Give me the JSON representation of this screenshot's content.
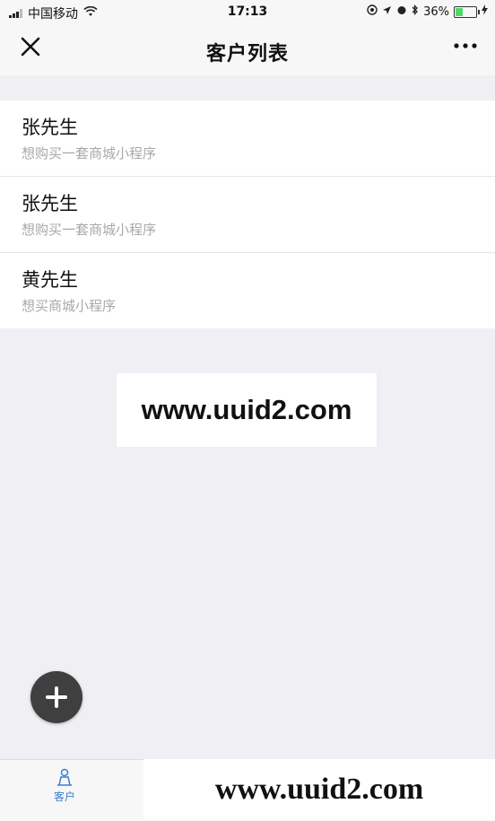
{
  "status_bar": {
    "carrier": "中国移动",
    "time": "17:13",
    "battery_percent": "36%",
    "battery_level": 0.36,
    "battery_color": "#4cd964"
  },
  "nav": {
    "close_icon": "close-icon",
    "title": "客户列表",
    "more_icon": "more-icon"
  },
  "customers": [
    {
      "name": "张先生",
      "desc": "想购买一套商城小程序"
    },
    {
      "name": "张先生",
      "desc": "想购买一套商城小程序"
    },
    {
      "name": "黄先生",
      "desc": "想买商城小程序"
    }
  ],
  "watermark": {
    "text": "www.uuid2.com"
  },
  "fab": {
    "icon": "plus-icon"
  },
  "tab_bar": {
    "items": [
      {
        "label": "客户",
        "icon": "customer-icon",
        "color": "#3b7dd8"
      }
    ],
    "watermark_text": "www.uuid2.com"
  }
}
